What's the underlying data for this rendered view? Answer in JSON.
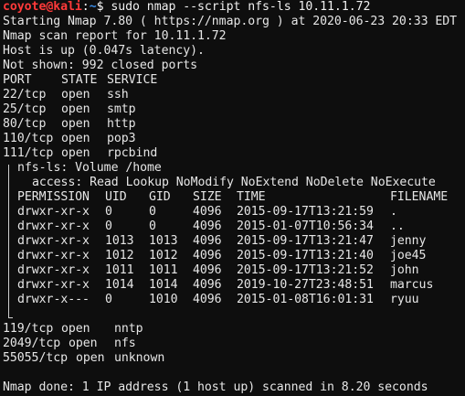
{
  "prompt": {
    "user_host": "coyote@kali",
    "separator": ":",
    "path": "~",
    "symbol": "$",
    "command": " sudo nmap --script nfs-ls 10.11.1.72"
  },
  "header_lines": [
    "Starting Nmap 7.80 ( https://nmap.org ) at 2020-06-23 20:33 EDT",
    "Nmap scan report for 10.11.1.72",
    "Host is up (0.047s latency).",
    "Not shown: 992 closed ports"
  ],
  "ports_header": {
    "port": "PORT",
    "state": "STATE",
    "service": "SERVICE"
  },
  "ports_top": [
    {
      "port": "22/tcp",
      "state": "open",
      "service": "ssh"
    },
    {
      "port": "25/tcp",
      "state": "open",
      "service": "smtp"
    },
    {
      "port": "80/tcp",
      "state": "open",
      "service": "http"
    },
    {
      "port": "110/tcp",
      "state": "open",
      "service": "pop3"
    },
    {
      "port": "111/tcp",
      "state": "open",
      "service": "rpcbind"
    }
  ],
  "nfs": {
    "volume_line": "nfs-ls: Volume /home",
    "access_line": "access: Read Lookup NoModify NoExtend NoDelete NoExecute",
    "columns": {
      "perm": "PERMISSION",
      "uid": "UID",
      "gid": "GID",
      "size": "SIZE",
      "time": "TIME",
      "fname": "FILENAME"
    },
    "rows": [
      {
        "perm": "drwxr-xr-x",
        "uid": "0",
        "gid": "0",
        "size": "4096",
        "time": "2015-09-17T13:21:59",
        "fname": "."
      },
      {
        "perm": "drwxr-xr-x",
        "uid": "0",
        "gid": "0",
        "size": "4096",
        "time": "2015-01-07T10:56:34",
        "fname": ".."
      },
      {
        "perm": "drwxr-xr-x",
        "uid": "1013",
        "gid": "1013",
        "size": "4096",
        "time": "2015-09-17T13:21:47",
        "fname": "jenny"
      },
      {
        "perm": "drwxr-xr-x",
        "uid": "1012",
        "gid": "1012",
        "size": "4096",
        "time": "2015-09-17T13:21:40",
        "fname": "joe45"
      },
      {
        "perm": "drwxr-xr-x",
        "uid": "1011",
        "gid": "1011",
        "size": "4096",
        "time": "2015-09-17T13:21:52",
        "fname": "john"
      },
      {
        "perm": "drwxr-xr-x",
        "uid": "1014",
        "gid": "1014",
        "size": "4096",
        "time": "2019-10-27T23:48:51",
        "fname": "marcus"
      },
      {
        "perm": "drwxr-x---",
        "uid": "0",
        "gid": "1010",
        "size": "4096",
        "time": "2015-01-08T16:01:31",
        "fname": "ryuu"
      }
    ]
  },
  "ports_bottom": [
    {
      "port": "119/tcp",
      "state": "open",
      "service": "nntp"
    },
    {
      "port": "2049/tcp",
      "state": "open",
      "service": "nfs"
    },
    {
      "port": "55055/tcp",
      "state": "open",
      "service": "unknown"
    }
  ],
  "footer_line": "Nmap done: 1 IP address (1 host up) scanned in 8.20 seconds",
  "colors": {
    "background": "#0e0e0e",
    "text": "#e6e6e6",
    "user": "#ff3a3a",
    "path": "#3b8eea"
  }
}
